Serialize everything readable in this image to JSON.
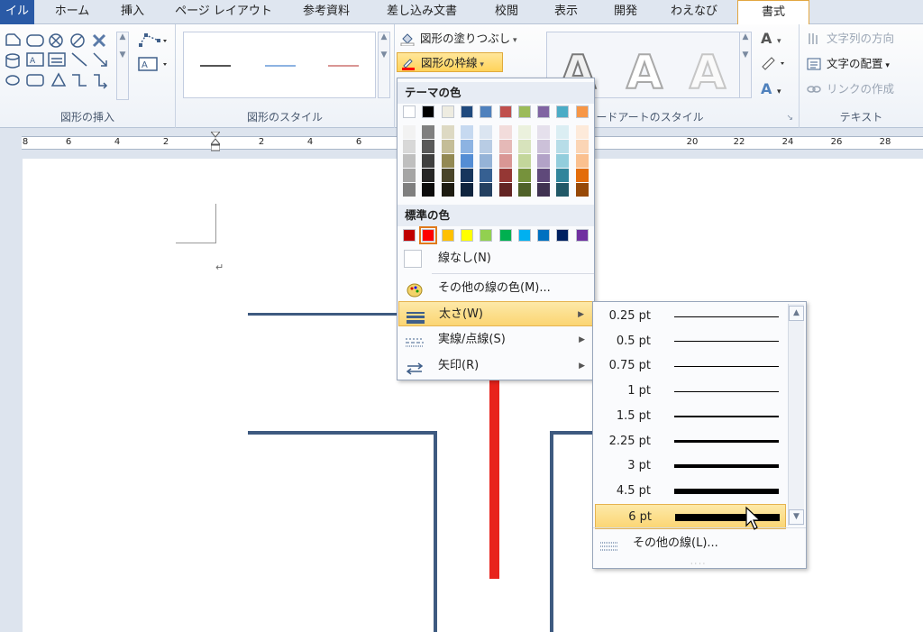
{
  "tabs": [
    "イル",
    "ホーム",
    "挿入",
    "ページ レイアウト",
    "参考資料",
    "差し込み文書",
    "校閲",
    "表示",
    "開発",
    "わえなび",
    "書式"
  ],
  "ribbon": {
    "groups": {
      "insert_shapes": "図形の挿入",
      "shape_styles": "図形のスタイル",
      "wordart_styles": "ワードアートのスタイル",
      "text": "テキスト"
    },
    "fill_button": "図形の塗りつぶし",
    "outline_button": "図形の枠線",
    "text_direction": "文字列の方向",
    "text_align": "文字の配置",
    "create_link": "リンクの作成",
    "wordart_letter": "A"
  },
  "menu": {
    "theme_colors_header": "テーマの色",
    "standard_colors_header": "標準の色",
    "no_line": "線なし(N)",
    "more_colors": "その他の線の色(M)...",
    "weight": "太さ(W)",
    "dashes": "実線/点線(S)",
    "arrows": "矢印(R)",
    "theme_colors_top": [
      "#ffffff",
      "#000000",
      "#eeece1",
      "#1f497d",
      "#4f81bd",
      "#c0504d",
      "#9bbb59",
      "#8064a2",
      "#4bacc6",
      "#f79646"
    ],
    "theme_colors_shades": [
      [
        "#f2f2f2",
        "#d8d8d8",
        "#bfbfbf",
        "#a5a5a5",
        "#7f7f7f"
      ],
      [
        "#7f7f7f",
        "#595959",
        "#3f3f3f",
        "#262626",
        "#0c0c0c"
      ],
      [
        "#ddd9c3",
        "#c4bd97",
        "#938953",
        "#494429",
        "#1d1b10"
      ],
      [
        "#c6d9f0",
        "#8db3e2",
        "#548dd4",
        "#17365d",
        "#0f243e"
      ],
      [
        "#dbe5f1",
        "#b8cce4",
        "#95b3d7",
        "#366092",
        "#244061"
      ],
      [
        "#f2dcdb",
        "#e5b9b7",
        "#d99694",
        "#953734",
        "#632423"
      ],
      [
        "#ebf1dd",
        "#d7e3bc",
        "#c3d69b",
        "#76923c",
        "#4f6128"
      ],
      [
        "#e5e0ec",
        "#ccc1d9",
        "#b2a2c7",
        "#5f497a",
        "#3f3151"
      ],
      [
        "#dbeef3",
        "#b7dde8",
        "#92cddc",
        "#31859b",
        "#205867"
      ],
      [
        "#fdeada",
        "#fbd5b5",
        "#fac08f",
        "#e36c09",
        "#974806"
      ]
    ],
    "standard_colors": [
      "#c00000",
      "#ff0000",
      "#ffc000",
      "#ffff00",
      "#92d050",
      "#00b050",
      "#00b0f0",
      "#0070c0",
      "#002060",
      "#7030a0"
    ]
  },
  "submenu": {
    "weights": [
      {
        "label": "0.25 pt",
        "value": 0.25
      },
      {
        "label": "0.5 pt",
        "value": 0.5
      },
      {
        "label": "0.75 pt",
        "value": 0.75
      },
      {
        "label": "1 pt",
        "value": 1
      },
      {
        "label": "1.5 pt",
        "value": 1.5
      },
      {
        "label": "2.25 pt",
        "value": 2.25
      },
      {
        "label": "3 pt",
        "value": 3
      },
      {
        "label": "4.5 pt",
        "value": 4.5
      },
      {
        "label": "6 pt",
        "value": 6
      }
    ],
    "selected": "6 pt",
    "more_lines": "その他の線(L)..."
  },
  "ruler": {
    "numbers": [
      "8",
      "6",
      "4",
      "2",
      "2",
      "4",
      "6",
      "20",
      "22",
      "24",
      "26",
      "28"
    ]
  }
}
